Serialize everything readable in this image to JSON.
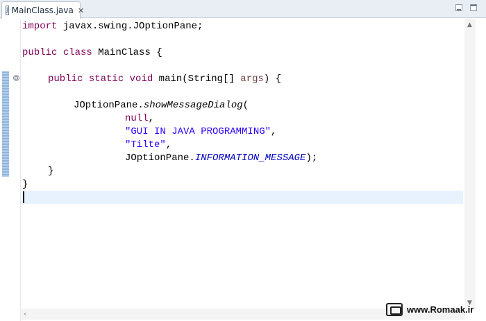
{
  "tab": {
    "file_icon": "J",
    "filename": "MainClass.java",
    "close": "✕"
  },
  "icons": {
    "file": "java-file-icon",
    "close": "close-icon",
    "fold": "fold-minus-icon",
    "minimize": "minimize-icon",
    "maximize": "maximize-icon"
  },
  "editor": {
    "fold_symbol": "⊖",
    "lines": {
      "l1": {
        "kw": "import",
        "rest": " javax.swing.JOptionPane;"
      },
      "l3": {
        "kw1": "public",
        "kw2": "class",
        "rest": " MainClass {"
      },
      "l5": {
        "kw1": "public",
        "kw2": "static",
        "kw3": "void",
        "mid": " main(String[] ",
        "param": "args",
        "end": ") {"
      },
      "l7": {
        "obj": "JOptionPane.",
        "method": "showMessageDialog",
        "end": "("
      },
      "l8": {
        "kw": "null",
        "end": ","
      },
      "l9": {
        "str": "\"GUI IN JAVA PROGRAMMING\"",
        "end": ","
      },
      "l10": {
        "str": "\"Tilte\"",
        "end": ","
      },
      "l11": {
        "obj": "JOptionPane.",
        "const": "INFORMATION_MESSAGE",
        "end": ");"
      },
      "l12": {
        "text": "}"
      },
      "l13": {
        "text": "}"
      }
    }
  },
  "scrollbar": {
    "up": "▲",
    "down": "▼",
    "left": "‹"
  },
  "watermark": {
    "text": "www.Romaak.ir"
  },
  "colors": {
    "keyword": "#7f0055",
    "string": "#2a00ff",
    "constant": "#0000c0",
    "current_line": "#e8f2fe"
  }
}
